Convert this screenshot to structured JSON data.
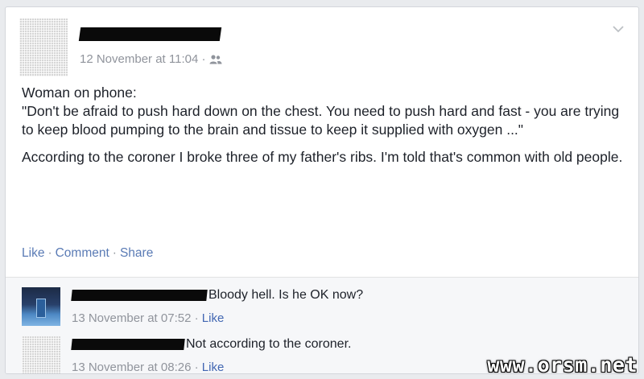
{
  "post": {
    "timestamp": "12 November at 11:04",
    "meta_separator": "·",
    "paragraphs": [
      "Woman on phone:",
      "\"Don't be afraid to push hard down on the chest. You need to push hard and fast - you are trying to keep blood pumping to the brain and tissue to keep it supplied with oxygen ...\"",
      "According to the coroner I broke three of my father's ribs. I'm told that's common with old people."
    ],
    "actions": {
      "like": "Like",
      "comment": "Comment",
      "share": "Share",
      "separator": "·"
    },
    "privacy_icon": "friends-icon",
    "menu_icon": "chevron-down-icon"
  },
  "comments": [
    {
      "text": "Bloody hell. Is he OK now?",
      "timestamp": "13 November at 07:52",
      "like": "Like"
    },
    {
      "text": "Not according to the coroner.",
      "timestamp": "13 November at 08:26",
      "like": "Like"
    }
  ],
  "watermark": "www.orsm.net",
  "colors": {
    "link": "#4267b2",
    "meta": "#90949c",
    "text": "#1d2129",
    "background": "#e9ebee"
  }
}
